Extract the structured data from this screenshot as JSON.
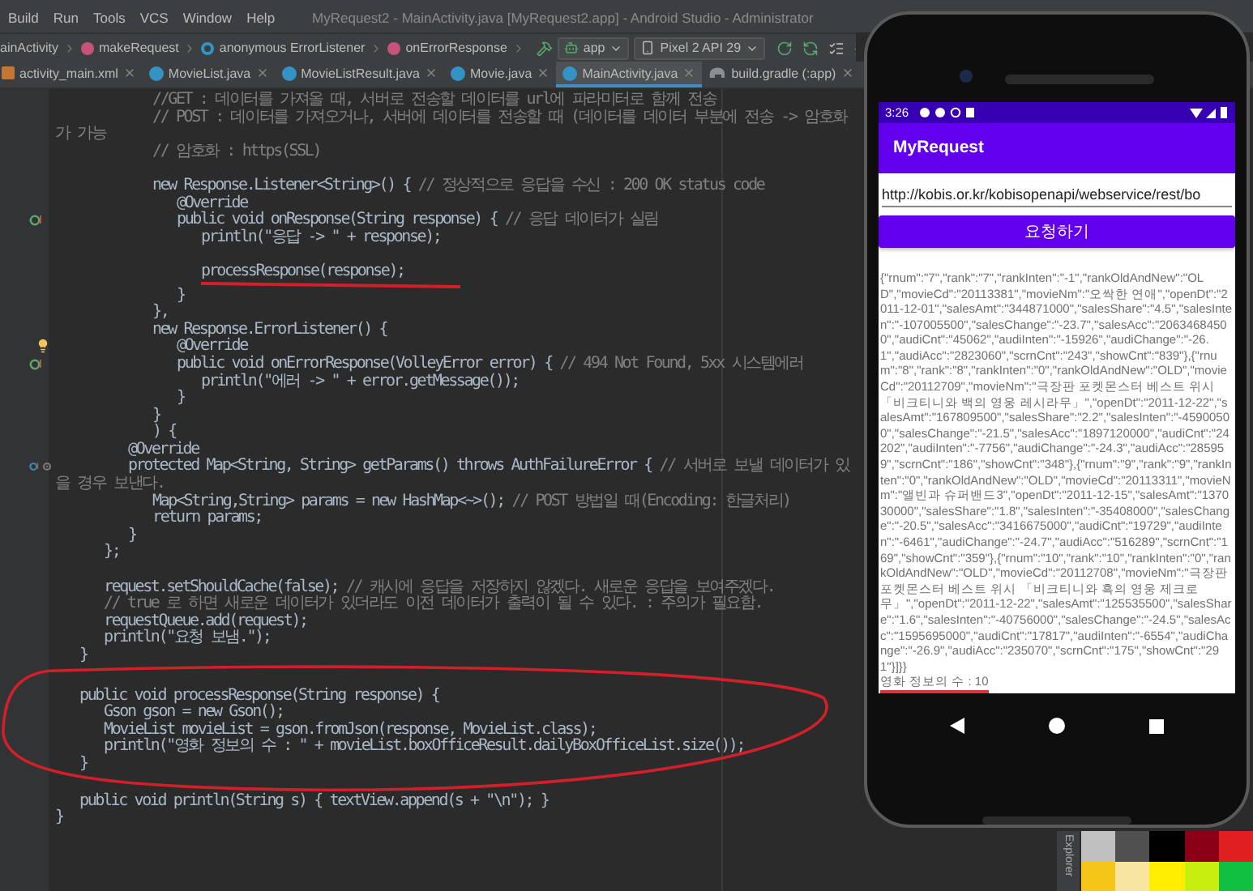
{
  "menu": [
    "Build",
    "Run",
    "Tools",
    "VCS",
    "Window",
    "Help"
  ],
  "window_title": "MyRequest2 - MainActivity.java [MyRequest2.app] - Android Studio - Administrator",
  "breadcrumbs": [
    {
      "text": "ainActivity",
      "kind": "none"
    },
    {
      "text": "makeRequest",
      "kind": "method"
    },
    {
      "text": "anonymous ErrorListener",
      "kind": "anonymous"
    },
    {
      "text": "onErrorResponse",
      "kind": "method"
    }
  ],
  "run_config": "app",
  "device": "Pixel 2 API 29",
  "tabs": [
    {
      "label": "activity_main.xml",
      "kind": "xml",
      "selected": false
    },
    {
      "label": "MovieList.java",
      "kind": "class",
      "selected": false
    },
    {
      "label": "MovieListResult.java",
      "kind": "class",
      "selected": false
    },
    {
      "label": "Movie.java",
      "kind": "class",
      "selected": false
    },
    {
      "label": "MainActivity.java",
      "kind": "class",
      "selected": true
    },
    {
      "label": "build.gradle (:app)",
      "kind": "gradle",
      "selected": false
    }
  ],
  "editor": {
    "blocks": [
      {
        "kind": "plain",
        "lines": [
          {
            "kind": "plain",
            "comment": "\t\t\t\t//GET : 데이터를 가져올 때, 서버로 전송할 데이터를 url에 파라미터로 함께 전송"
          },
          {
            "kind": "plain",
            "comment": "\t\t\t\t// POST : 데이터를 가져오거나, 서버에 데이터를 전송할 때 (데이터를 데이터 부분에 전송 -> 암호화가 가능"
          },
          {
            "kind": "plain",
            "comment": "\t\t\t\t// 암호화 : https(SSL)"
          },
          {
            "kind": "blank"
          },
          {
            "kind": "plain",
            "code": "\t\t\t\tnew Response.Listener<String>() { ",
            "comment": "// 정상적으로 응답을 수신 : 200 OK status code"
          },
          {
            "kind": "plain",
            "code": "\t\t\t\t\t@Override"
          },
          {
            "kind": "override",
            "code": "\t\t\t\t\tpublic void onResponse(String response) { ",
            "comment": "// 응답 데이터가 실림"
          },
          {
            "kind": "plain",
            "code": "\t\t\t\t\t\tprintln(\"응답 -> \" + response);"
          },
          {
            "kind": "blank"
          }
        ]
      },
      {
        "kind": "underlined",
        "lines": [
          {
            "kind": "plain",
            "code": "\t\t\t\t\t\tprocessResponse(response);"
          }
        ]
      },
      {
        "kind": "plain",
        "lines": [
          {
            "kind": "plain",
            "code": "\t\t\t\t\t}"
          },
          {
            "kind": "plain",
            "code": "\t\t\t\t},"
          },
          {
            "kind": "plain",
            "code": "\t\t\t\tnew Response.ErrorListener() {"
          },
          {
            "kind": "bulb",
            "code": "\t\t\t\t\t@Override"
          },
          {
            "kind": "override",
            "code": "\t\t\t\t\tpublic void onErrorResponse(VolleyError error) { ",
            "comment": "// 494 Not Found, 5xx 시스템에러"
          },
          {
            "kind": "plain",
            "code": "\t\t\t\t\t\tprintln(\"에러 -> \" + error.getMessage());"
          },
          {
            "kind": "plain",
            "code": "\t\t\t\t\t}"
          },
          {
            "kind": "plain",
            "code": "\t\t\t\t}"
          },
          {
            "kind": "plain",
            "code": "\t\t\t\t) {"
          },
          {
            "kind": "plain",
            "code": "\t\t\t@Override"
          },
          {
            "kind": "override_at",
            "code": "\t\t\tprotected Map<String, String> getParams() throws AuthFailureError { ",
            "comment": "// 서버로 보낼 데이터가 있을 경우 보낸다."
          },
          {
            "kind": "plain",
            "code": "\t\t\t\tMap<String,String> params = new HashMap<~>(); ",
            "comment": "// POST 방법일 때(Encoding: 한글처리)"
          },
          {
            "kind": "plain",
            "code": "\t\t\t\treturn params;"
          },
          {
            "kind": "plain",
            "code": "\t\t\t}"
          },
          {
            "kind": "plain",
            "code": "\t\t};"
          },
          {
            "kind": "blank"
          },
          {
            "kind": "plain",
            "code": "\t\trequest.setShouldCache(false); ",
            "comment": "// 캐시에 응답을 저장하지 않겠다. 새로운 응답을 보여주겠다."
          },
          {
            "kind": "plain",
            "comment": "\t\t// true 로 하면 새로운 데이터가 있더라도 이전 데이터가 출력이 될 수 있다. : 주의가 필요함."
          },
          {
            "kind": "plain",
            "code": "\t\trequestQueue.add(request);"
          },
          {
            "kind": "plain",
            "code": "\t\tprintln(\"요청 보냄.\");"
          },
          {
            "kind": "plain",
            "code": "\t}"
          }
        ]
      },
      {
        "kind": "circled",
        "lines": [
          {
            "kind": "plain",
            "code": "\tpublic void processResponse(String response) {"
          },
          {
            "kind": "plain",
            "code": "\t\tGson gson = new Gson();"
          },
          {
            "kind": "plain",
            "code": "\t\tMovieList movieList = gson.fromJson(response, MovieList.class);"
          },
          {
            "kind": "plain",
            "code": "\t\tprintln(\"영화 정보의 수 : \" + movieList.boxOfficeResult.dailyBoxOfficeList.size());"
          },
          {
            "kind": "plain",
            "code": "\t}"
          }
        ]
      },
      {
        "kind": "plain",
        "lines": [
          {
            "kind": "plain",
            "code": "\tpublic void println(String s) { textView.append(s + \"\\n\"); }"
          },
          {
            "kind": "plain",
            "code": "}"
          }
        ]
      }
    ]
  },
  "emulator": {
    "status_time": "3:26",
    "app_title": "MyRequest",
    "url_field": {
      "value": "http://kobis.or.kr/kobisopenapi/webservice/rest/bo"
    },
    "button": "요청하기",
    "output": [
      {
        "text": "{\"rnum\":\"7\",\"rank\":\"7\",\"rankInten\":\"-1\",\"rankOldAndNew\":\"OLD\",\"movieCd\":\"20113381\",\"movieNm\":\"오싹한 연애\",\"openDt\":\"2011-12-01\",\"salesAmt\":\"344871000\",\"salesShare\":\"4.5\",\"salesInten\":\"-107005500\",\"salesChange\":\"-23.7\",\"salesAcc\":\"20634684500\",\"audiCnt\":\"45062\",\"audiInten\":\"-15926\",\"audiChange\":\"-26.1\",\"audiAcc\":\"2823060\",\"scrnCnt\":\"243\",\"showCnt\":\"839\"},{\"rnum\":\"8\",\"rank\":\"8\",\"rankInten\":\"0\",\"rankOldAndNew\":\"OLD\",\"movieCd\":\"20112709\",\"movieNm\":\"극장판 포켓몬스터 베스트 위시「비크티니와 백의 영웅 레시라무」\",\"openDt\":\"2011-12-22\",\"salesAmt\":\"167809500\",\"salesShare\":\"2.2\",\"salesInten\":\"-45900500\",\"salesChange\":\"-21.5\",\"salesAcc\":\"1897120000\",\"audiCnt\":\"24202\",\"audiInten\":\"-7756\",\"audiChange\":\"-24.3\",\"audiAcc\":\"285959\",\"scrnCnt\":\"186\",\"showCnt\":\"348\"},{\"rnum\":\"9\",\"rank\":\"9\",\"rankInten\":\"0\",\"rankOldAndNew\":\"OLD\",\"movieCd\":\"20113311\",\"movieNm\":\"앨빈과 슈퍼밴드3\",\"openDt\":\"2011-12-15\",\"salesAmt\":\"137030000\",\"salesShare\":\"1.8\",\"salesInten\":\"-35408000\",\"salesChange\":\"-20.5\",\"salesAcc\":\"3416675000\",\"audiCnt\":\"19729\",\"audiInten\":\"-6461\",\"audiChange\":\"-24.7\",\"audiAcc\":\"516289\",\"scrnCnt\":\"169\",\"showCnt\":\"359\"},{\"rnum\":\"10\",\"rank\":\"10\",\"rankInten\":\"0\",\"rankOldAndNew\":\"OLD\",\"movieCd\":\"20112708\",\"movieNm\":\"극장판 포켓몬스터 베스트 위시 「비크티니와 흑의 영웅 제크로무」\",\"openDt\":\"2011-12-22\",\"salesAmt\":\"125535500\",\"salesShare\":\"1.6\",\"salesInten\":\"-40756000\",\"salesChange\":\"-24.5\",\"salesAcc\":\"1595695000\",\"audiCnt\":\"17817\",\"audiInten\":\"-6554\",\"audiChange\":\"-26.9\",\"audiAcc\":\"235070\",\"scrnCnt\":\"175\",\"showCnt\":\"291\"}]}}",
        "underlined": false
      },
      {
        "text": "영화 정보의 수 : 10",
        "underlined": true
      }
    ]
  },
  "side_panel_label": "Explorer",
  "swatches": [
    {
      "color": "#c0c0c0"
    },
    {
      "color": "#505050"
    },
    {
      "color": "#000000"
    },
    {
      "color": "#8b0016"
    },
    {
      "color": "#e02020"
    },
    {
      "color": "#f5c518"
    },
    {
      "color": "#f8e6a0"
    },
    {
      "color": "#ffee00"
    },
    {
      "color": "#c8ee10"
    },
    {
      "color": "#10c040"
    }
  ]
}
